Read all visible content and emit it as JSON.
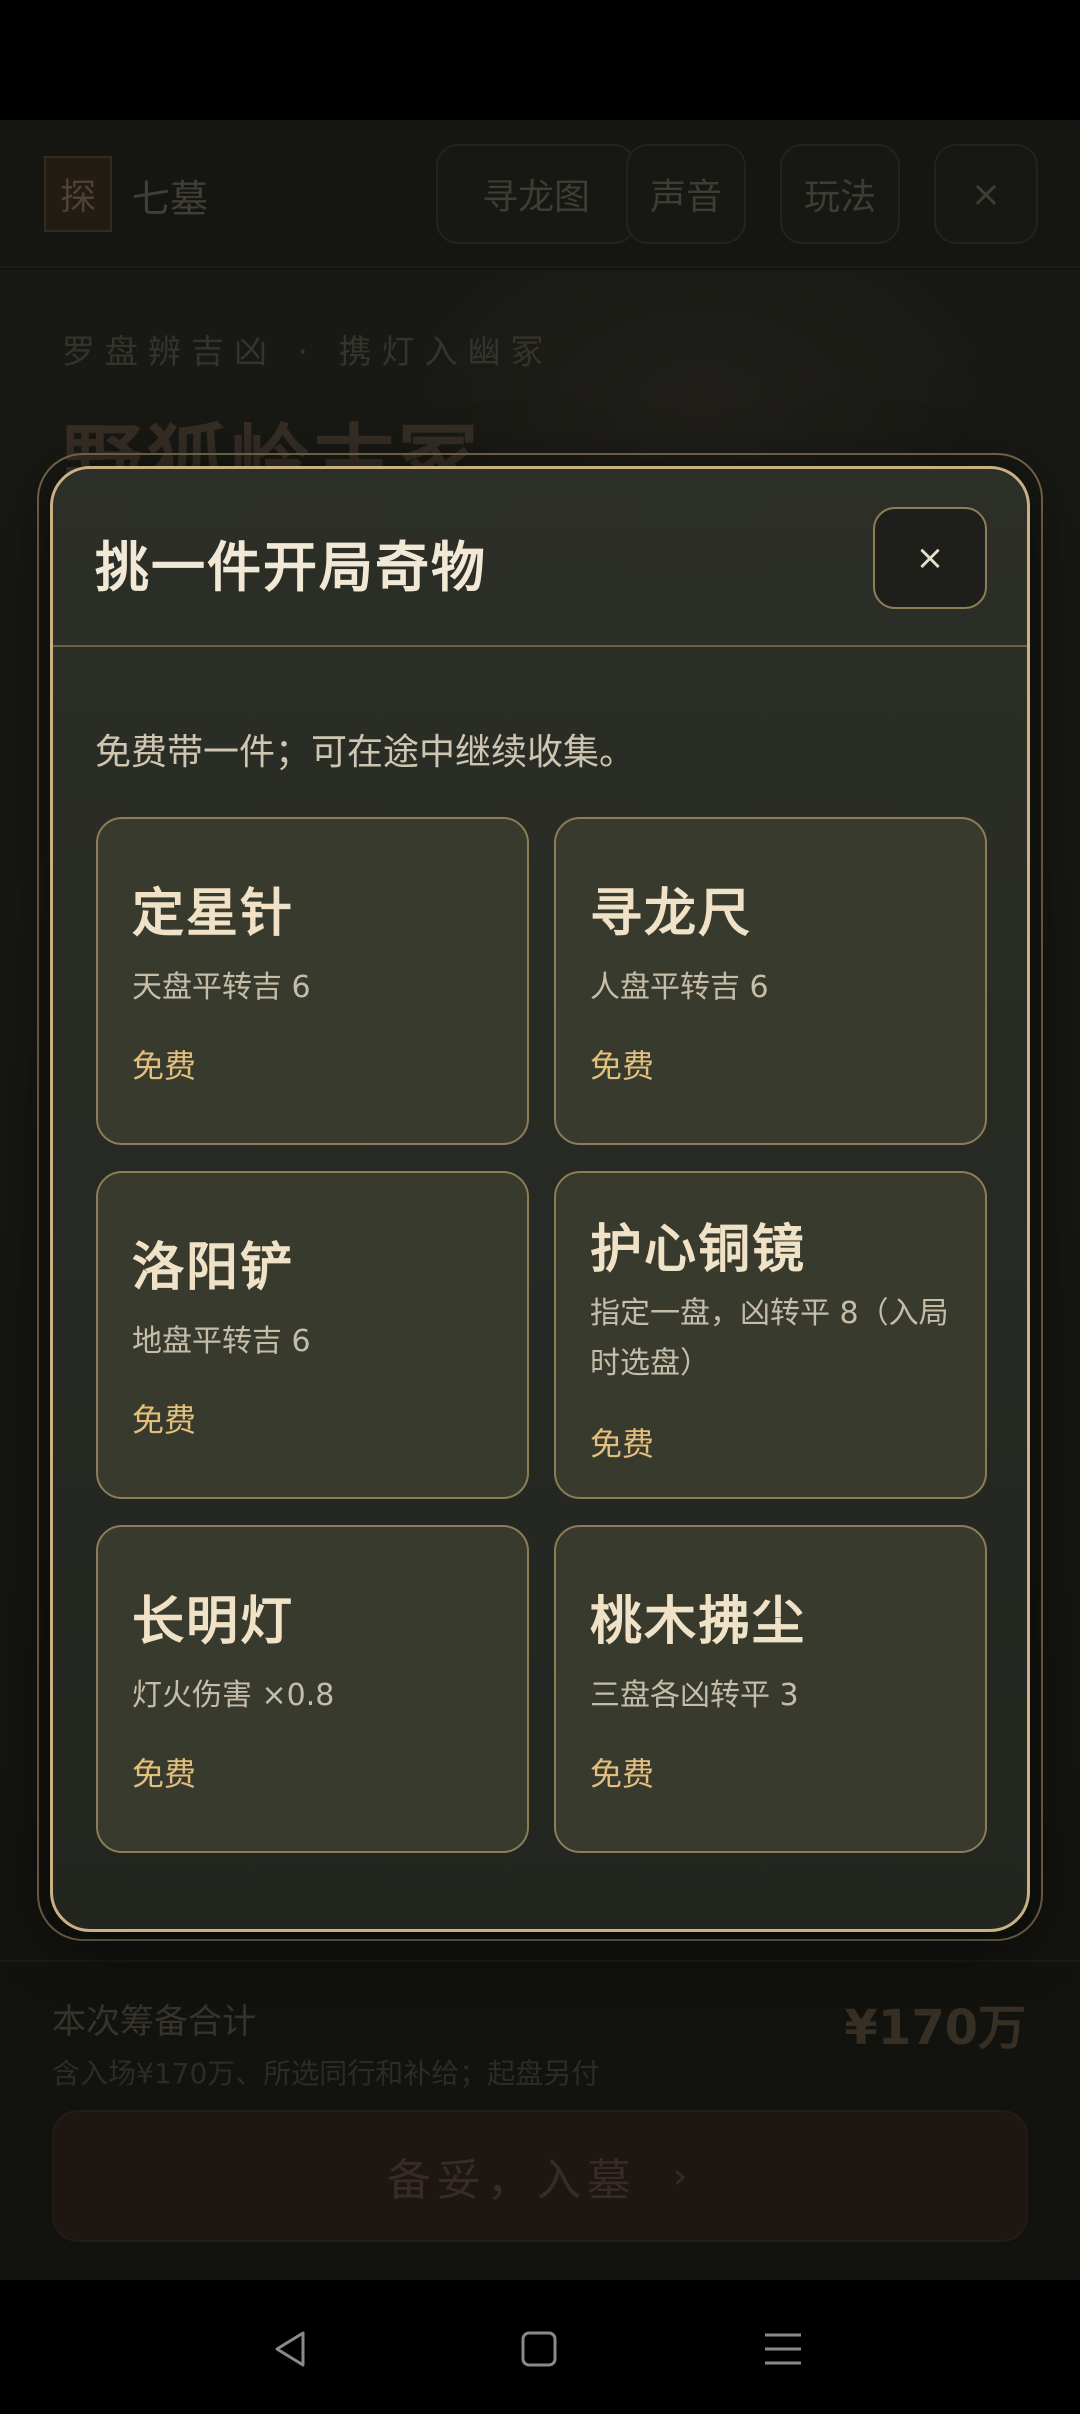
{
  "app": {
    "logo_char": "探",
    "title": "七墓",
    "header_buttons": {
      "map": "寻龙图",
      "sound": "声音",
      "rules": "玩法",
      "close": "×"
    },
    "hero_kicker": "罗盘辨吉凶 · 携灯入幽冢",
    "hero_title": "野狐岭古冢",
    "footer": {
      "label": "本次筹备合计",
      "sub": "含入场¥170万、所选同行和补给；起盘另付",
      "total": "¥170万",
      "enter_button": "备妥，入墓",
      "enter_chevron": "›"
    }
  },
  "modal": {
    "title": "挑一件开局奇物",
    "close": "×",
    "description": "免费带一件；可在途中继续收集。",
    "items": [
      {
        "name": "定星针",
        "effect": "天盘平转吉 6",
        "price": "免费"
      },
      {
        "name": "寻龙尺",
        "effect": "人盘平转吉 6",
        "price": "免费"
      },
      {
        "name": "洛阳铲",
        "effect": "地盘平转吉 6",
        "price": "免费"
      },
      {
        "name": "护心铜镜",
        "effect": "指定一盘，凶转平 8（入局时选盘）",
        "price": "免费"
      },
      {
        "name": "长明灯",
        "effect": "灯火伤害 ×0.8",
        "price": "免费"
      },
      {
        "name": "桃木拂尘",
        "effect": "三盘各凶转平 3",
        "price": "免费"
      }
    ]
  },
  "nav": {
    "icons": [
      "back-icon",
      "home-icon",
      "menu-icon"
    ]
  }
}
